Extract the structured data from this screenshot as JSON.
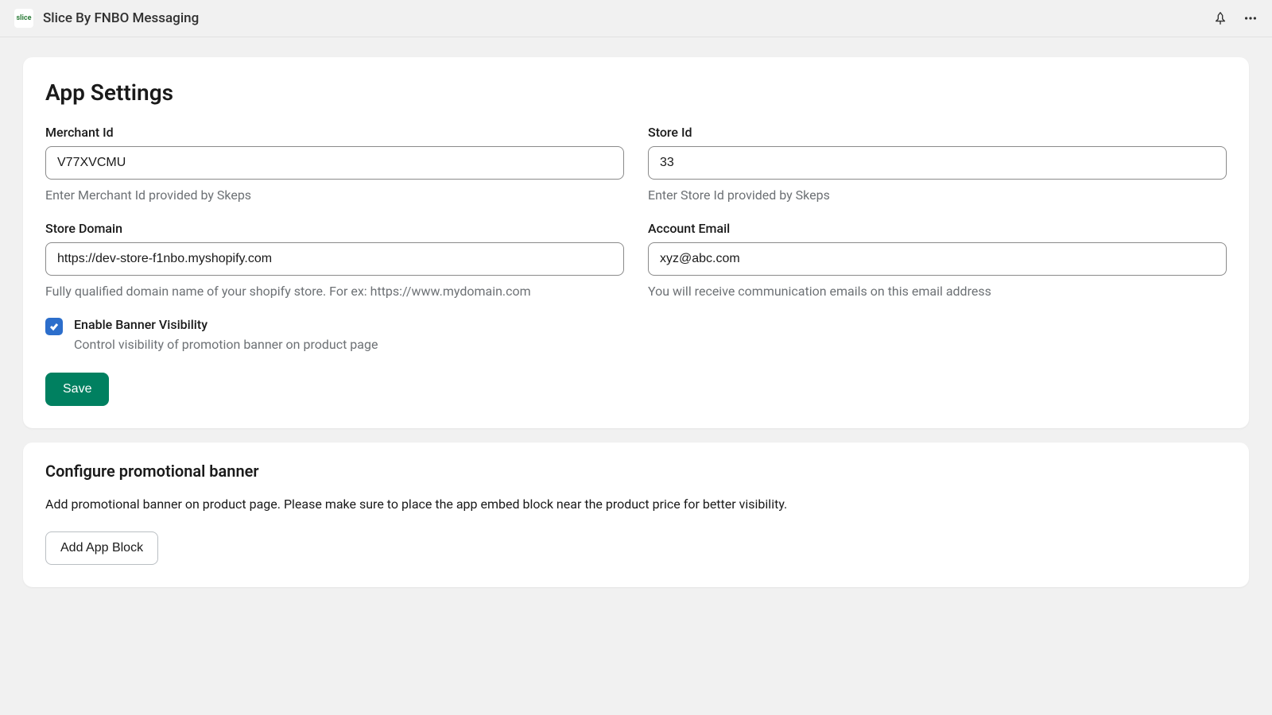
{
  "header": {
    "app_title": "Slice By FNBO Messaging",
    "app_icon_text": "slice"
  },
  "settings": {
    "title": "App Settings",
    "fields": {
      "merchant_id": {
        "label": "Merchant Id",
        "value": "V77XVCMU",
        "hint": "Enter Merchant Id provided by Skeps"
      },
      "store_id": {
        "label": "Store Id",
        "value": "33",
        "hint": "Enter Store Id provided by Skeps"
      },
      "store_domain": {
        "label": "Store Domain",
        "value": "https://dev-store-f1nbo.myshopify.com",
        "hint": "Fully qualified domain name of your shopify store. For ex: https://www.mydomain.com"
      },
      "account_email": {
        "label": "Account Email",
        "value": "xyz@abc.com",
        "hint": "You will receive communication emails on this email address"
      }
    },
    "banner_visibility": {
      "label": "Enable Banner Visibility",
      "hint": "Control visibility of promotion banner on product page",
      "checked": true
    },
    "save_label": "Save"
  },
  "promo_banner": {
    "title": "Configure promotional banner",
    "description": "Add promotional banner on product page. Please make sure to place the app embed block near the product price for better visibility.",
    "button_label": "Add App Block"
  }
}
